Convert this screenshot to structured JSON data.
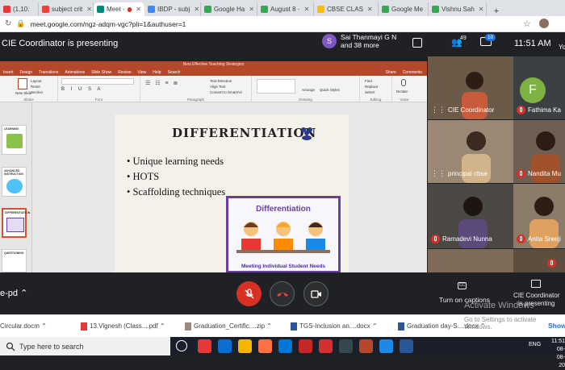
{
  "browser": {
    "tabs": [
      {
        "title": "(1,10:",
        "color": "#e53935"
      },
      {
        "title": "subject crit",
        "color": "#ea4335"
      },
      {
        "title": "Meet -",
        "color": "#00897b"
      },
      {
        "title": "IBDP - subj",
        "color": "#4285f4"
      },
      {
        "title": "Google Ha",
        "color": "#34a853"
      },
      {
        "title": "August 8 -",
        "color": "#34a853"
      },
      {
        "title": "CBSE CLAS",
        "color": "#fbbc04"
      },
      {
        "title": "Google Me",
        "color": "#34a853"
      },
      {
        "title": "Vishnu Sah",
        "color": "#34a853"
      }
    ],
    "new_tab": "+",
    "url": "meet.google.com/ngz-adqm-vgc?pli=1&authuser=1"
  },
  "meet": {
    "presenting_banner": "CIE Coordinator is presenting",
    "presenter": {
      "initial": "S",
      "name": "Sai Thanmayi G N",
      "more": "and 38 more"
    },
    "people_count": "49",
    "chat_count": "10",
    "time": "11:51 AM",
    "right_edge_label": "Yo",
    "bottom_left_label": "e-pd"
  },
  "ppt": {
    "window_title": "New Effective Teaching Strategies",
    "menu": [
      "Insert",
      "Design",
      "Transitions",
      "Animations",
      "Slide Show",
      "Review",
      "View",
      "Help",
      "Search"
    ],
    "share": "Share",
    "comments": "Comments",
    "ribbon_groups": [
      "Slides",
      "Font",
      "Paragraph",
      "Drawing",
      "Editing",
      "Voice"
    ],
    "ribbon_items": {
      "new_slide": "New Slide",
      "reuse_slides": "Reuse Slides",
      "layout": "Layout",
      "reset": "Reset",
      "section": "Section",
      "text_direction": "Text Direction",
      "align_text": "Align Text",
      "convert_smartart": "Convert to SmartArt",
      "arrange": "Arrange",
      "quick_styles": "Quick Styles",
      "find": "Find",
      "replace": "Replace",
      "select": "Select",
      "dictate": "Dictate"
    },
    "thumb_labels": [
      "DIFFERENTIATION",
      "LEARNING",
      "ADVANCED INSTRUCTION",
      "DIFFERENTIATION",
      "QUESTIONING"
    ],
    "slide": {
      "title": "DIFFERENTIATION",
      "bullets": [
        "Unique learning needs",
        "HOTS",
        "Scaffolding techniques"
      ],
      "image_title": "Differentiation",
      "image_caption": "Meeting Individual Student Needs"
    }
  },
  "participants": [
    {
      "name": "",
      "bg": "#6b5a48"
    },
    {
      "name": "CIE Coordinator",
      "bg": "#7a6855",
      "muted": false
    },
    {
      "name": "Fathima Ka",
      "avatar": "F",
      "bg": "#3c4043",
      "muted": true
    },
    {
      "name": "principal cbse",
      "bg": "#9a8874",
      "muted": false
    },
    {
      "name": "Nandita Mu",
      "bg": "#6f5f52",
      "muted": true
    },
    {
      "name": "Ramadevi Nunna",
      "bg": "#4b4844",
      "muted": true
    },
    {
      "name": "Anita Sreeji",
      "bg": "#8a7c69",
      "muted": true
    },
    {
      "name": "",
      "bg": "#7d6a57"
    },
    {
      "name": "",
      "bg": "#5d4e40"
    }
  ],
  "controls": {
    "captions": "Turn on captions",
    "presenting": [
      "CIE Coordinator",
      "is presenting"
    ],
    "watermark": [
      "Activate Windows",
      "Go to Settings to activate Windows."
    ]
  },
  "downloads": {
    "items": [
      "Circular.docm",
      "13.Vignesh (Class....pdf",
      "Graduation_Certific....zip",
      "TGS-Inclusion an....docx",
      "Graduation day-S....docx"
    ],
    "show_all": "Show"
  },
  "taskbar": {
    "search_placeholder": "Type here to search",
    "lang": "ENG",
    "time": "11:51",
    "date": "08-08-20"
  }
}
